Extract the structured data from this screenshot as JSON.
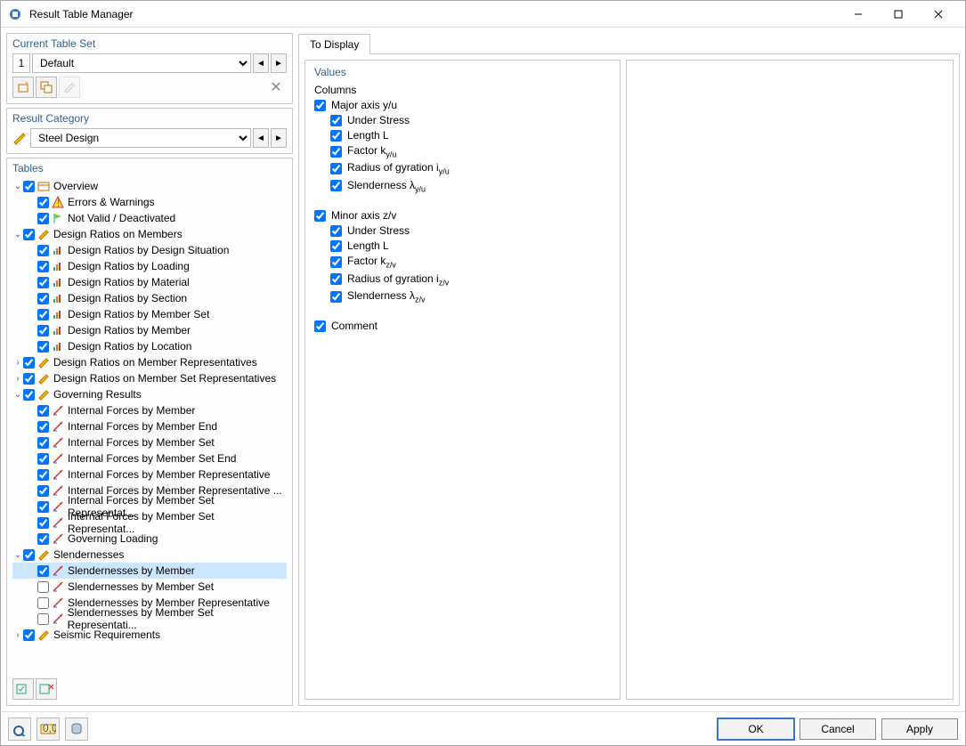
{
  "window": {
    "title": "Result Table Manager"
  },
  "currentTableSet": {
    "title": "Current Table Set",
    "number": "1",
    "name": "Default"
  },
  "resultCategory": {
    "title": "Result Category",
    "name": "Steel Design"
  },
  "tablesTitle": "Tables",
  "tree": [
    {
      "lvl": 0,
      "tw": "v",
      "chk": true,
      "icon": "overview",
      "label": "Overview"
    },
    {
      "lvl": 1,
      "tw": " ",
      "chk": true,
      "icon": "warn",
      "label": "Errors & Warnings"
    },
    {
      "lvl": 1,
      "tw": " ",
      "chk": true,
      "icon": "flag",
      "label": "Not Valid / Deactivated"
    },
    {
      "lvl": 0,
      "tw": "v",
      "chk": true,
      "icon": "pencil",
      "label": "Design Ratios on Members"
    },
    {
      "lvl": 1,
      "tw": " ",
      "chk": true,
      "icon": "bars",
      "label": "Design Ratios by Design Situation"
    },
    {
      "lvl": 1,
      "tw": " ",
      "chk": true,
      "icon": "bars",
      "label": "Design Ratios by Loading"
    },
    {
      "lvl": 1,
      "tw": " ",
      "chk": true,
      "icon": "bars",
      "label": "Design Ratios by Material"
    },
    {
      "lvl": 1,
      "tw": " ",
      "chk": true,
      "icon": "bars",
      "label": "Design Ratios by Section"
    },
    {
      "lvl": 1,
      "tw": " ",
      "chk": true,
      "icon": "bars",
      "label": "Design Ratios by Member Set"
    },
    {
      "lvl": 1,
      "tw": " ",
      "chk": true,
      "icon": "bars",
      "label": "Design Ratios by Member"
    },
    {
      "lvl": 1,
      "tw": " ",
      "chk": true,
      "icon": "bars",
      "label": "Design Ratios by Location"
    },
    {
      "lvl": 0,
      "tw": ">",
      "chk": true,
      "icon": "pencil",
      "label": "Design Ratios on Member Representatives"
    },
    {
      "lvl": 0,
      "tw": ">",
      "chk": true,
      "icon": "pencil",
      "label": "Design Ratios on Member Set Representatives"
    },
    {
      "lvl": 0,
      "tw": "v",
      "chk": true,
      "icon": "pencil",
      "label": "Governing Results"
    },
    {
      "lvl": 1,
      "tw": " ",
      "chk": true,
      "icon": "force",
      "label": "Internal Forces by Member"
    },
    {
      "lvl": 1,
      "tw": " ",
      "chk": true,
      "icon": "force",
      "label": "Internal Forces by Member End"
    },
    {
      "lvl": 1,
      "tw": " ",
      "chk": true,
      "icon": "force",
      "label": "Internal Forces by Member Set"
    },
    {
      "lvl": 1,
      "tw": " ",
      "chk": true,
      "icon": "force",
      "label": "Internal Forces by Member Set End"
    },
    {
      "lvl": 1,
      "tw": " ",
      "chk": true,
      "icon": "force",
      "label": "Internal Forces by Member Representative"
    },
    {
      "lvl": 1,
      "tw": " ",
      "chk": true,
      "icon": "force",
      "label": "Internal Forces by Member Representative ..."
    },
    {
      "lvl": 1,
      "tw": " ",
      "chk": true,
      "icon": "force",
      "label": "Internal Forces by Member Set Representat..."
    },
    {
      "lvl": 1,
      "tw": " ",
      "chk": true,
      "icon": "force",
      "label": "Internal Forces by Member Set Representat..."
    },
    {
      "lvl": 1,
      "tw": " ",
      "chk": true,
      "icon": "force",
      "label": "Governing Loading"
    },
    {
      "lvl": 0,
      "tw": "v",
      "chk": true,
      "icon": "pencil",
      "label": "Slendernesses"
    },
    {
      "lvl": 1,
      "tw": " ",
      "chk": true,
      "icon": "force",
      "label": "Slendernesses by Member",
      "sel": true
    },
    {
      "lvl": 1,
      "tw": " ",
      "chk": false,
      "icon": "force",
      "label": "Slendernesses by Member Set"
    },
    {
      "lvl": 1,
      "tw": " ",
      "chk": false,
      "icon": "force",
      "label": "Slendernesses by Member Representative"
    },
    {
      "lvl": 1,
      "tw": " ",
      "chk": false,
      "icon": "force",
      "label": "Slendernesses by Member Set Representati..."
    },
    {
      "lvl": 0,
      "tw": ">",
      "chk": true,
      "icon": "pencil",
      "label": "Seismic Requirements"
    }
  ],
  "toDisplay": {
    "tab": "To Display",
    "valuesTitle": "Values",
    "columnsLabel": "Columns",
    "majorAxis": {
      "label": "Major axis y/u",
      "children": [
        {
          "label": "Under Stress"
        },
        {
          "label": "Length L"
        },
        {
          "label": "Factor k",
          "sub": "y/u"
        },
        {
          "label": "Radius of gyration i",
          "sub": "y/u"
        },
        {
          "label": "Slenderness λ",
          "sub": "y/u"
        }
      ]
    },
    "minorAxis": {
      "label": "Minor axis z/v",
      "children": [
        {
          "label": "Under Stress"
        },
        {
          "label": "Length L"
        },
        {
          "label": "Factor k",
          "sub": "z/v"
        },
        {
          "label": "Radius of gyration i",
          "sub": "z/v"
        },
        {
          "label": "Slenderness λ",
          "sub": "z/v"
        }
      ]
    },
    "comment": "Comment"
  },
  "footer": {
    "ok": "OK",
    "cancel": "Cancel",
    "apply": "Apply"
  }
}
